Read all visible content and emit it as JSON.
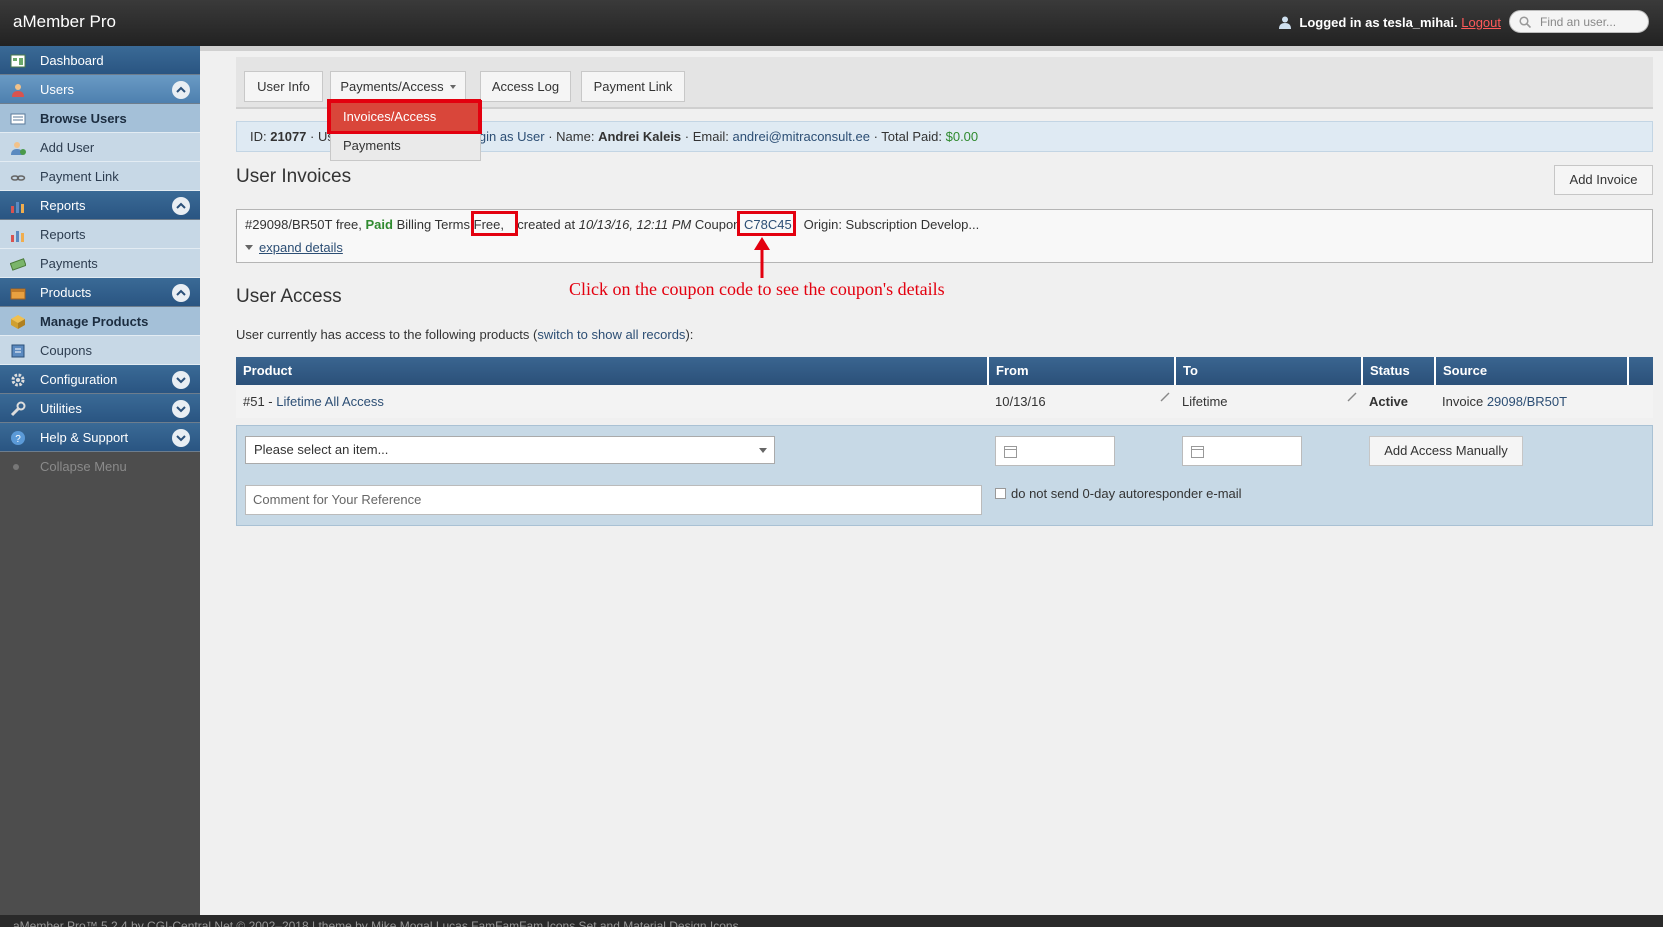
{
  "app": {
    "title": "aMember Pro"
  },
  "header": {
    "logged_prefix": "Logged in as tesla_mihai.",
    "logout_label": "Logout",
    "search_placeholder": "Find an user..."
  },
  "sidebar": {
    "dashboard": "Dashboard",
    "users": "Users",
    "browse_users": "Browse Users",
    "add_user": "Add User",
    "payment_link": "Payment Link",
    "reports": "Reports",
    "reports_sub": "Reports",
    "payments": "Payments",
    "products": "Products",
    "manage_products": "Manage Products",
    "coupons": "Coupons",
    "configuration": "Configuration",
    "utilities": "Utilities",
    "help_support": "Help & Support",
    "collapse_menu": "Collapse Menu"
  },
  "tabs": {
    "user_info": "User Info",
    "payments_access": "Payments/Access",
    "access_log": "Access Log",
    "payment_link": "Payment Link"
  },
  "dropdown": {
    "invoices_access": "Invoices/Access",
    "payments": "Payments"
  },
  "infobar": {
    "id_label": "ID:",
    "id_value": "21077",
    "sep1": " · Us",
    "login_as_user": "gin as User",
    "name_label": " · Name:",
    "name_value": "Andrei Kaleis",
    "email_label": " · Email:",
    "email_value": "andrei@mitraconsult.ee",
    "total_label": " · Total Paid:",
    "total_value": "$0.00"
  },
  "invoices": {
    "title": "User Invoices",
    "add_button": "Add Invoice",
    "invoice_id": "#29098/BR50T free,",
    "status": "Paid",
    "billing_terms_label": "Billing Terms",
    "billing_terms_value": "Free,",
    "created_label": "created at",
    "created_value": "10/13/16, 12:11 PM",
    "coupon_label": "Coupon",
    "coupon_code": "C78C45",
    "origin": "Origin: Subscription Develop...",
    "expand_label": "expand details"
  },
  "annotation": {
    "text": "Click on the coupon code to see the coupon's details"
  },
  "access": {
    "title": "User Access",
    "note_prefix": "User currently has access to the following products (",
    "note_link": "switch to show all records",
    "note_suffix": "):",
    "columns": [
      "Product",
      "From",
      "To",
      "Status",
      "Source"
    ],
    "row": {
      "product_prefix": "#51 - ",
      "product_link": "Lifetime All Access",
      "from": "10/13/16",
      "to": "Lifetime",
      "status": "Active",
      "source_prefix": "Invoice ",
      "source_link": "29098/BR50T"
    },
    "select_placeholder": "Please select an item...",
    "add_manually": "Add Access Manually",
    "comment_placeholder": "Comment for Your Reference",
    "autoresponder_label": "do not send 0-day autoresponder e-mail"
  },
  "footer": {
    "text": "aMember Pro™ 5.2.4 by CGI-Central.Net © 2002–2018 | theme by Mike Mogal Lucas FamFamFam Icons Set and Material Design Icons"
  },
  "colors": {
    "accent_red": "#e3000f",
    "nav_blue": "#2b5079",
    "paid_green": "#2f8a2f"
  }
}
